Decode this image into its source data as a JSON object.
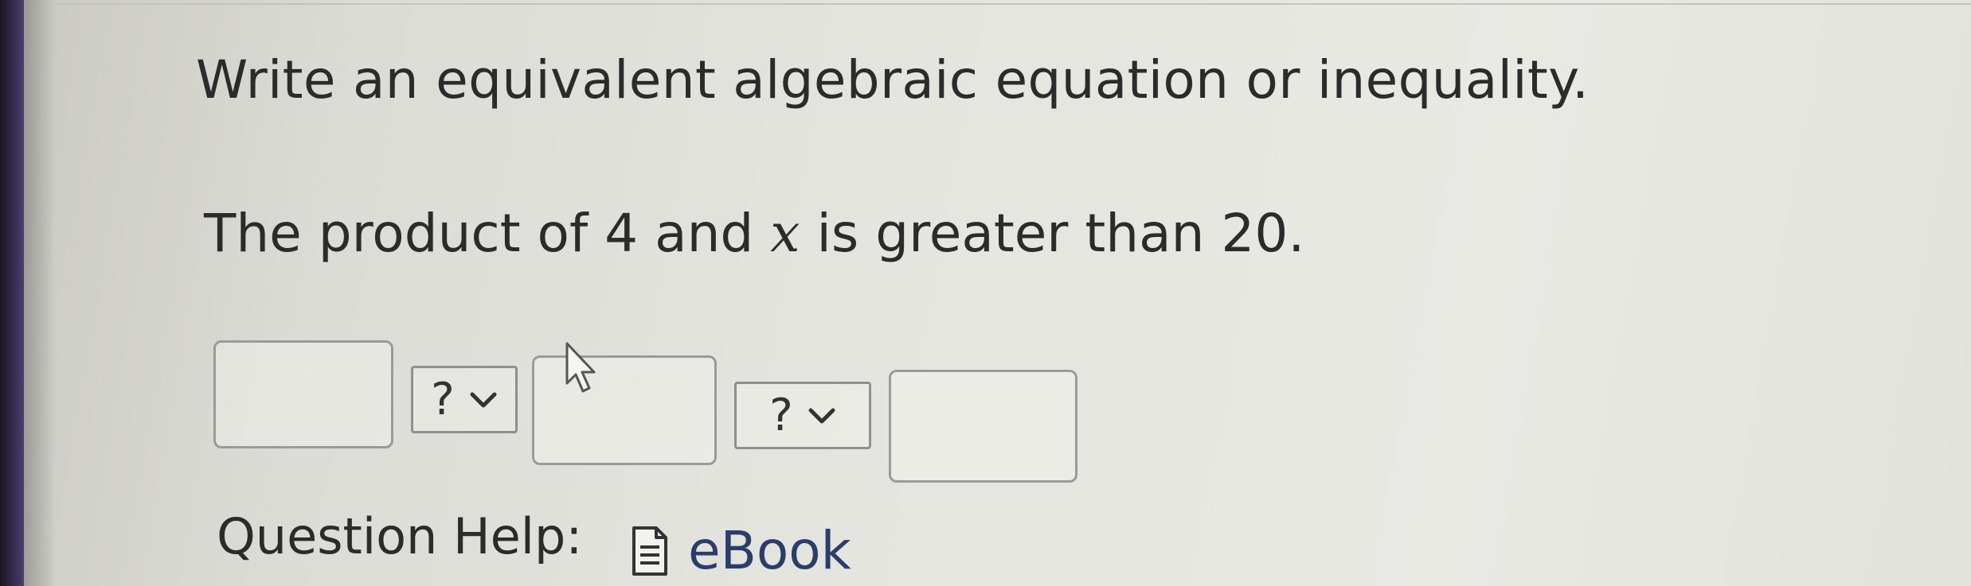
{
  "question": {
    "instruction": "Write an equivalent algebraic equation or inequality.",
    "statement_before_var": "The product of 4 and ",
    "variable": "x",
    "statement_after_var": " is greater than 20."
  },
  "answer_inputs": [
    {
      "value": "",
      "placeholder": ""
    },
    {
      "value": "",
      "placeholder": ""
    },
    {
      "value": "",
      "placeholder": ""
    }
  ],
  "operator_selects": [
    {
      "selected": "?",
      "icon": "chevron-down-icon"
    },
    {
      "selected": "?",
      "icon": "chevron-down-icon"
    }
  ],
  "question_help": {
    "label": "Question Help:",
    "links": [
      {
        "label": "eBook",
        "icon": "document-icon"
      }
    ]
  },
  "colors": {
    "text": "#2b2b2b",
    "link": "#2a3d6b",
    "input_border": "#9a9a9a",
    "background": "#e5e5df"
  }
}
